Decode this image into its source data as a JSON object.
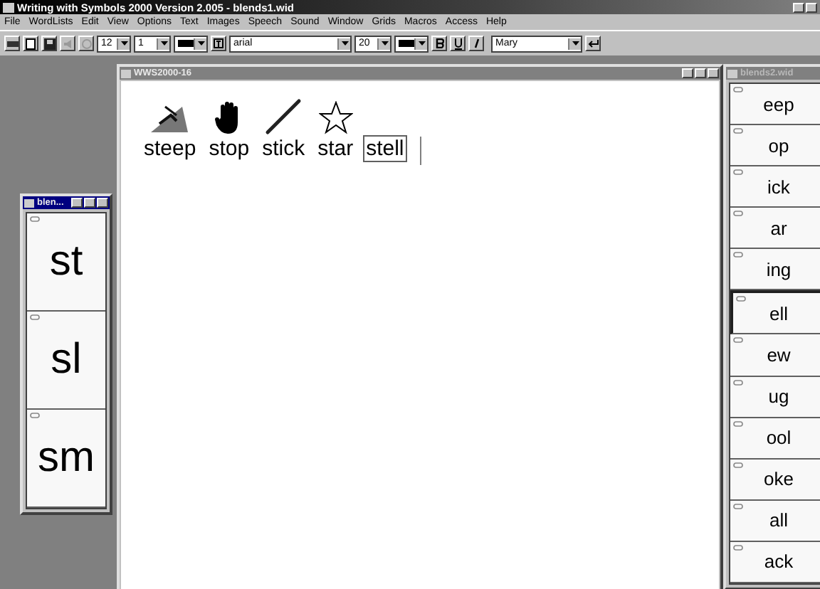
{
  "window": {
    "title": "Writing with Symbols 2000 Version 2.005 - blends1.wid"
  },
  "menu": [
    "File",
    "WordLists",
    "Edit",
    "View",
    "Options",
    "Text",
    "Images",
    "Speech",
    "Sound",
    "Window",
    "Grids",
    "Macros",
    "Access",
    "Help"
  ],
  "toolbar": {
    "font_size": "12",
    "line_spacing": "1",
    "font": "arial",
    "symbol_size": "20",
    "voice": "Mary"
  },
  "document": {
    "title": "WWS2000-16",
    "words": [
      {
        "text": "steep",
        "kind": "hill",
        "selected": false
      },
      {
        "text": "stop",
        "kind": "hand",
        "selected": false
      },
      {
        "text": "stick",
        "kind": "stick",
        "selected": false
      },
      {
        "text": "star",
        "kind": "star",
        "selected": false
      },
      {
        "text": "stell",
        "selected": true
      }
    ]
  },
  "left_grid": {
    "title": "blen...",
    "cells": [
      {
        "text": "st",
        "selected": false
      },
      {
        "text": "sl",
        "selected": false
      },
      {
        "text": "sm",
        "selected": false
      }
    ]
  },
  "right_grid": {
    "title": "blends2.wid",
    "cells": [
      {
        "text": "eep",
        "selected": false
      },
      {
        "text": "op",
        "selected": false
      },
      {
        "text": "ick",
        "selected": false
      },
      {
        "text": "ar",
        "selected": false
      },
      {
        "text": "ing",
        "selected": false
      },
      {
        "text": "ell",
        "selected": true
      },
      {
        "text": "ew",
        "selected": false
      },
      {
        "text": "ug",
        "selected": false
      },
      {
        "text": "ool",
        "selected": false
      },
      {
        "text": "oke",
        "selected": false
      },
      {
        "text": "all",
        "selected": false
      },
      {
        "text": "ack",
        "selected": false
      }
    ]
  }
}
